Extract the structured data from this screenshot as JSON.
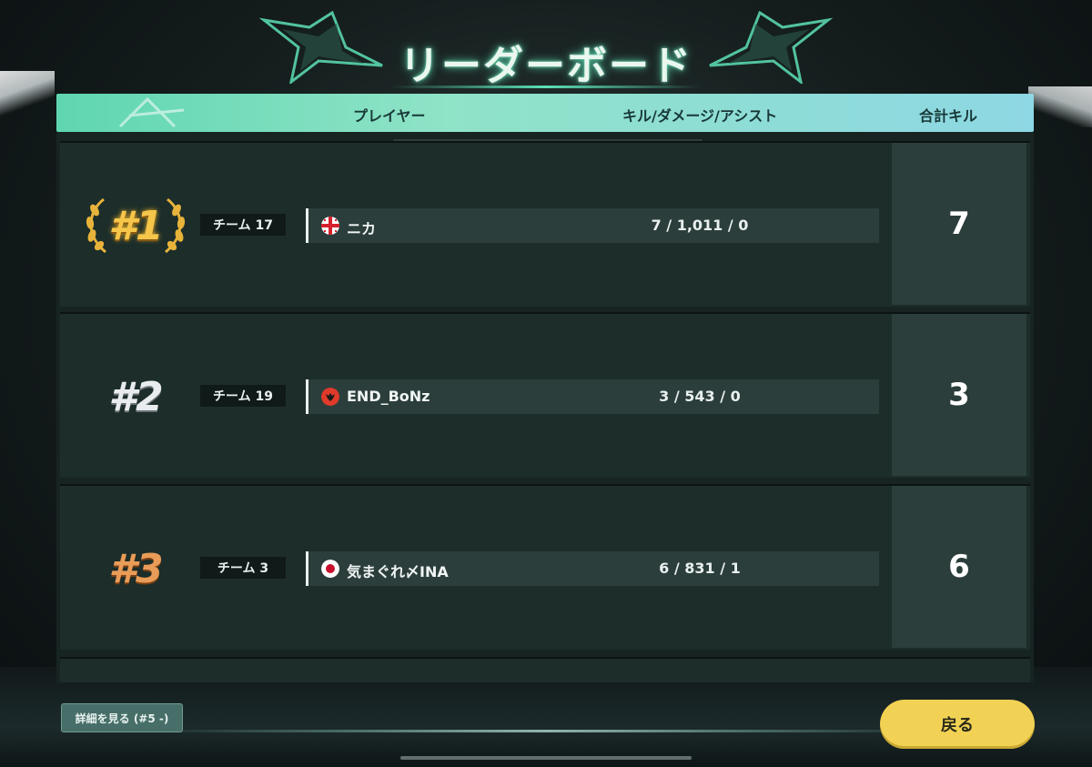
{
  "title": "リーダーボード",
  "header": {
    "player_col": "プレイヤー",
    "stats_col": "キル/ダメージ/アシスト",
    "total_col": "合計キル"
  },
  "rows": [
    {
      "rank": "#1",
      "team": "チーム 17",
      "flag": "flag-circle-red-cross",
      "player": "ニカ",
      "stats": "7 / 1,011 / 0",
      "total": "7"
    },
    {
      "rank": "#2",
      "team": "チーム 19",
      "flag": "flag-circle-red-eagle",
      "player": "END_BoNz",
      "stats": "3 / 543 / 0",
      "total": "3"
    },
    {
      "rank": "#3",
      "team": "チーム 3",
      "flag": "flag-circle-japan",
      "player": "気まぐれ〆INA",
      "stats": "6 / 831 / 1",
      "total": "6"
    }
  ],
  "buttons": {
    "details": "詳細を見る (#5 -)",
    "back": "戻る"
  },
  "colors": {
    "header_gradient_start": "#5fd6b0",
    "header_gradient_end": "#8ed7e4",
    "gold": "#f5c64a",
    "back_button": "#f2d254"
  }
}
